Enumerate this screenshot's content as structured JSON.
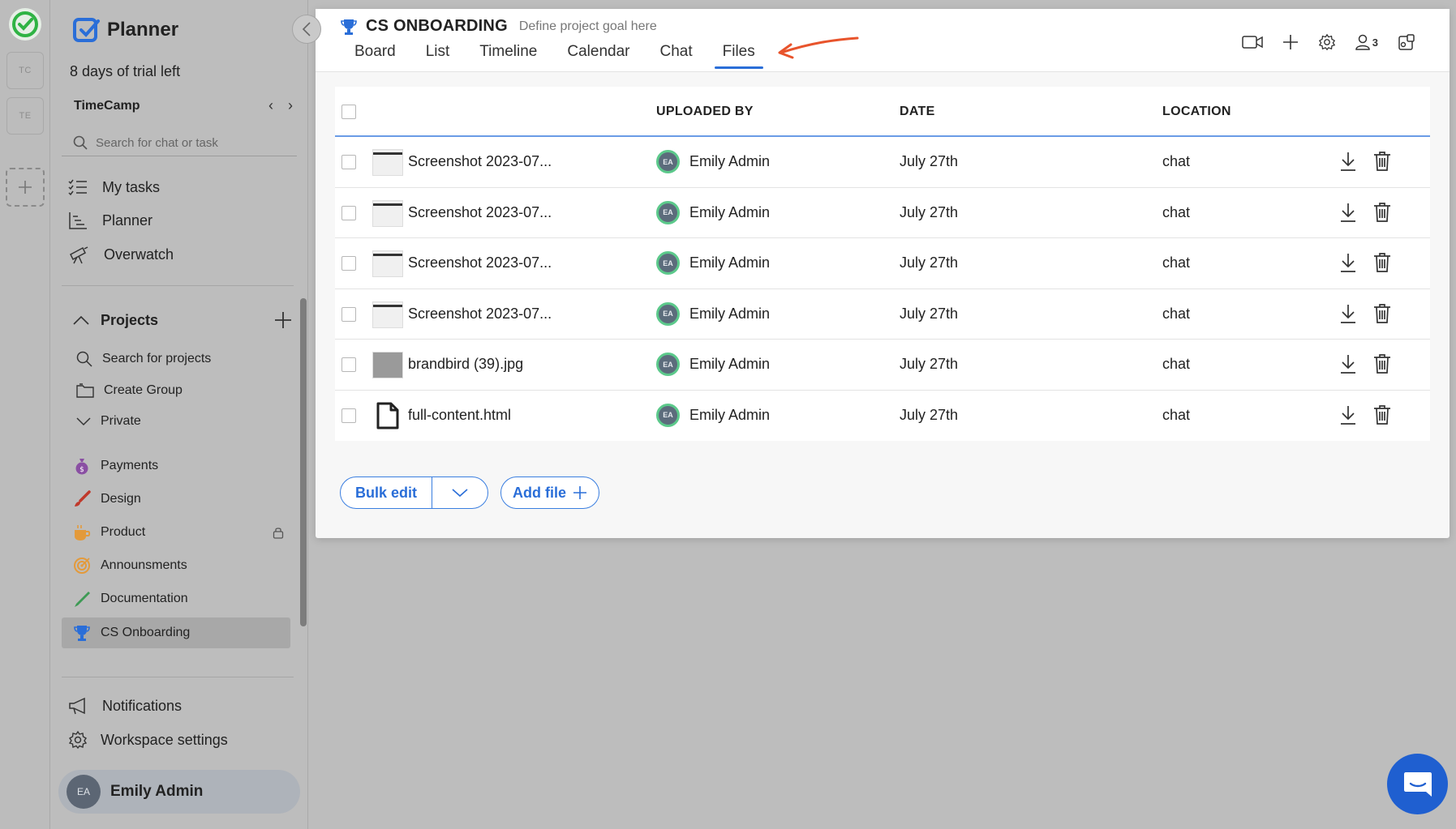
{
  "rail": {
    "workspaces": [
      "TC",
      "TE"
    ]
  },
  "sidebar": {
    "brand": "Planner",
    "trial": "8 days of trial left",
    "workspace_name": "TimeCamp",
    "search_placeholder": "Search for chat or task",
    "nav": {
      "my_tasks": "My tasks",
      "planner": "Planner",
      "overwatch": "Overwatch"
    },
    "projects": {
      "title": "Projects",
      "search": "Search for projects",
      "create_group": "Create Group",
      "private": "Private",
      "items": [
        {
          "label": "Payments",
          "icon": "money-bag-icon"
        },
        {
          "label": "Design",
          "icon": "brush-icon"
        },
        {
          "label": "Product",
          "icon": "coffee-icon"
        },
        {
          "label": "Announsments",
          "icon": "target-icon"
        },
        {
          "label": "Documentation",
          "icon": "pen-icon"
        },
        {
          "label": "CS Onboarding",
          "icon": "trophy-icon"
        }
      ]
    },
    "notifications": "Notifications",
    "workspace_settings": "Workspace settings",
    "user": {
      "initials": "EA",
      "name": "Emily Admin"
    }
  },
  "header": {
    "title": "CS ONBOARDING",
    "goal_placeholder": "Define project goal here",
    "tabs": [
      "Board",
      "List",
      "Timeline",
      "Calendar",
      "Chat",
      "Files"
    ],
    "active_tab": "Files",
    "member_count": "3"
  },
  "table": {
    "headers": {
      "uploaded_by": "UPLOADED BY",
      "date": "DATE",
      "location": "LOCATION"
    },
    "rows": [
      {
        "name": "Screenshot 2023-07...",
        "uploader_initials": "EA",
        "uploader": "Emily Admin",
        "date": "July 27th",
        "location": "chat",
        "thumb": "screenshot"
      },
      {
        "name": "Screenshot 2023-07...",
        "uploader_initials": "EA",
        "uploader": "Emily Admin",
        "date": "July 27th",
        "location": "chat",
        "thumb": "screenshot"
      },
      {
        "name": "Screenshot 2023-07...",
        "uploader_initials": "EA",
        "uploader": "Emily Admin",
        "date": "July 27th",
        "location": "chat",
        "thumb": "screenshot"
      },
      {
        "name": "Screenshot 2023-07...",
        "uploader_initials": "EA",
        "uploader": "Emily Admin",
        "date": "July 27th",
        "location": "chat",
        "thumb": "screenshot"
      },
      {
        "name": "brandbird (39).jpg",
        "uploader_initials": "EA",
        "uploader": "Emily Admin",
        "date": "July 27th",
        "location": "chat",
        "thumb": "image"
      },
      {
        "name": "full-content.html",
        "uploader_initials": "EA",
        "uploader": "Emily Admin",
        "date": "July 27th",
        "location": "chat",
        "thumb": "file"
      }
    ]
  },
  "actions": {
    "bulk_edit": "Bulk edit",
    "add_file": "Add file"
  },
  "colors": {
    "accent": "#2a6ed8",
    "brand_green": "#2fb344",
    "arrow": "#e8542c"
  }
}
